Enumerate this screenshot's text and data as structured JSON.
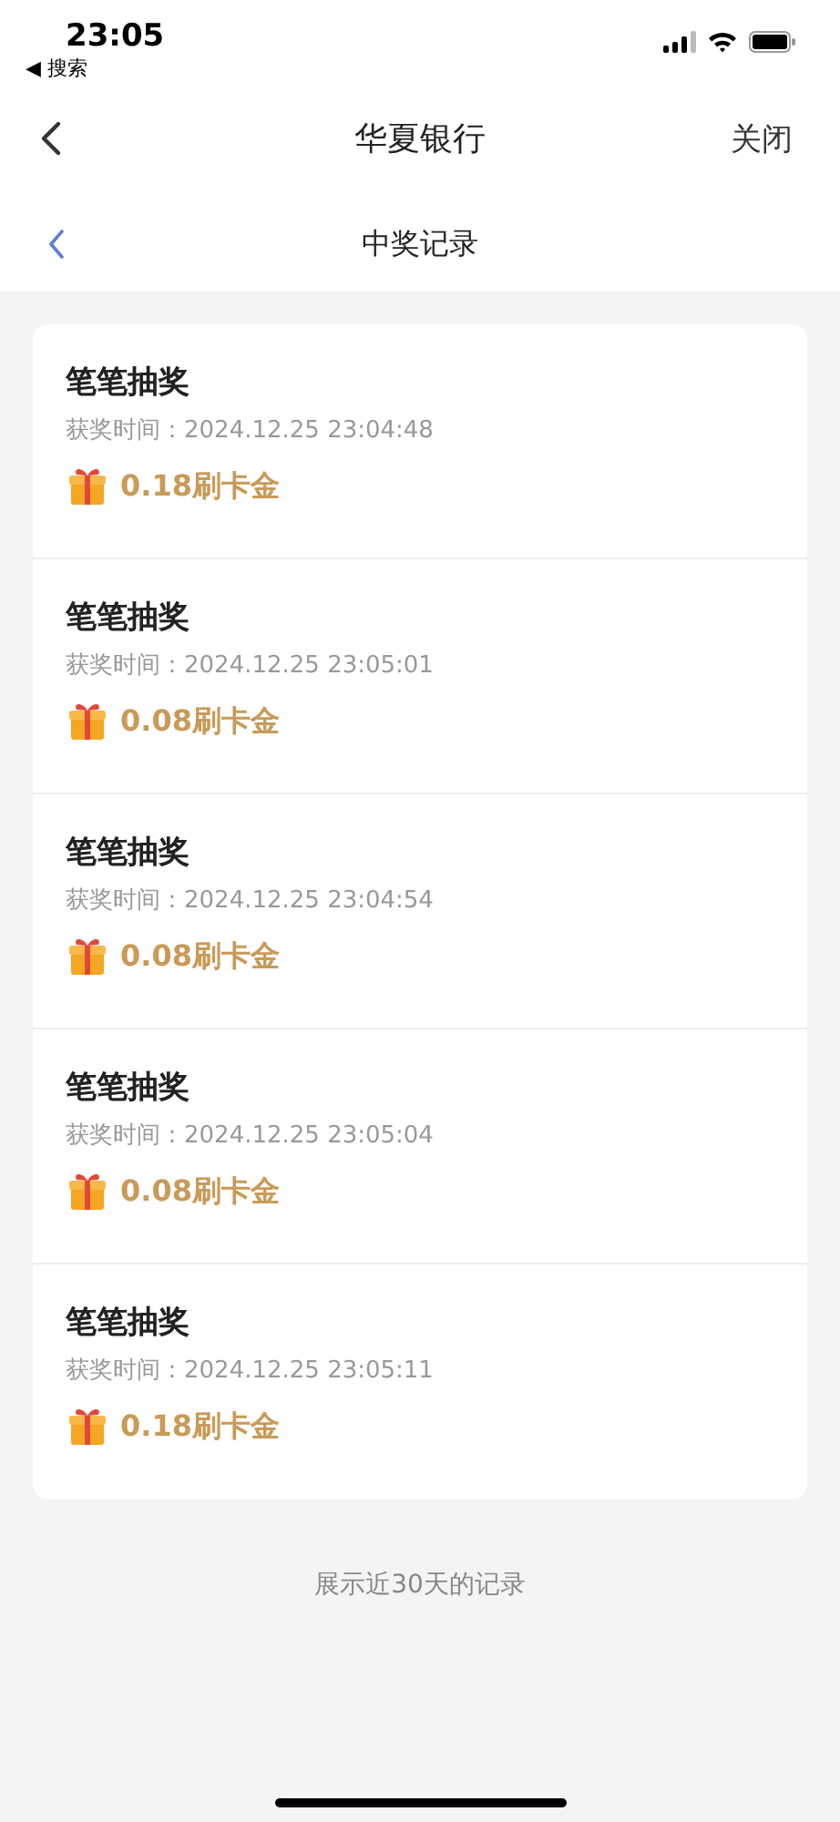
{
  "status_bar": {
    "time": "23:05",
    "back_label": "◀ 搜索"
  },
  "nav": {
    "title": "华夏银行",
    "close": "关闭"
  },
  "sub_nav": {
    "title": "中奖记录"
  },
  "records": [
    {
      "title": "笔笔抽奖",
      "time": "获奖时间：2024.12.25 23:04:48",
      "prize": "0.18刷卡金"
    },
    {
      "title": "笔笔抽奖",
      "time": "获奖时间：2024.12.25 23:05:01",
      "prize": "0.08刷卡金"
    },
    {
      "title": "笔笔抽奖",
      "time": "获奖时间：2024.12.25 23:04:54",
      "prize": "0.08刷卡金"
    },
    {
      "title": "笔笔抽奖",
      "time": "获奖时间：2024.12.25 23:05:04",
      "prize": "0.08刷卡金"
    },
    {
      "title": "笔笔抽奖",
      "time": "获奖时间：2024.12.25 23:05:11",
      "prize": "0.18刷卡金"
    }
  ],
  "footer": "展示近30天的记录"
}
